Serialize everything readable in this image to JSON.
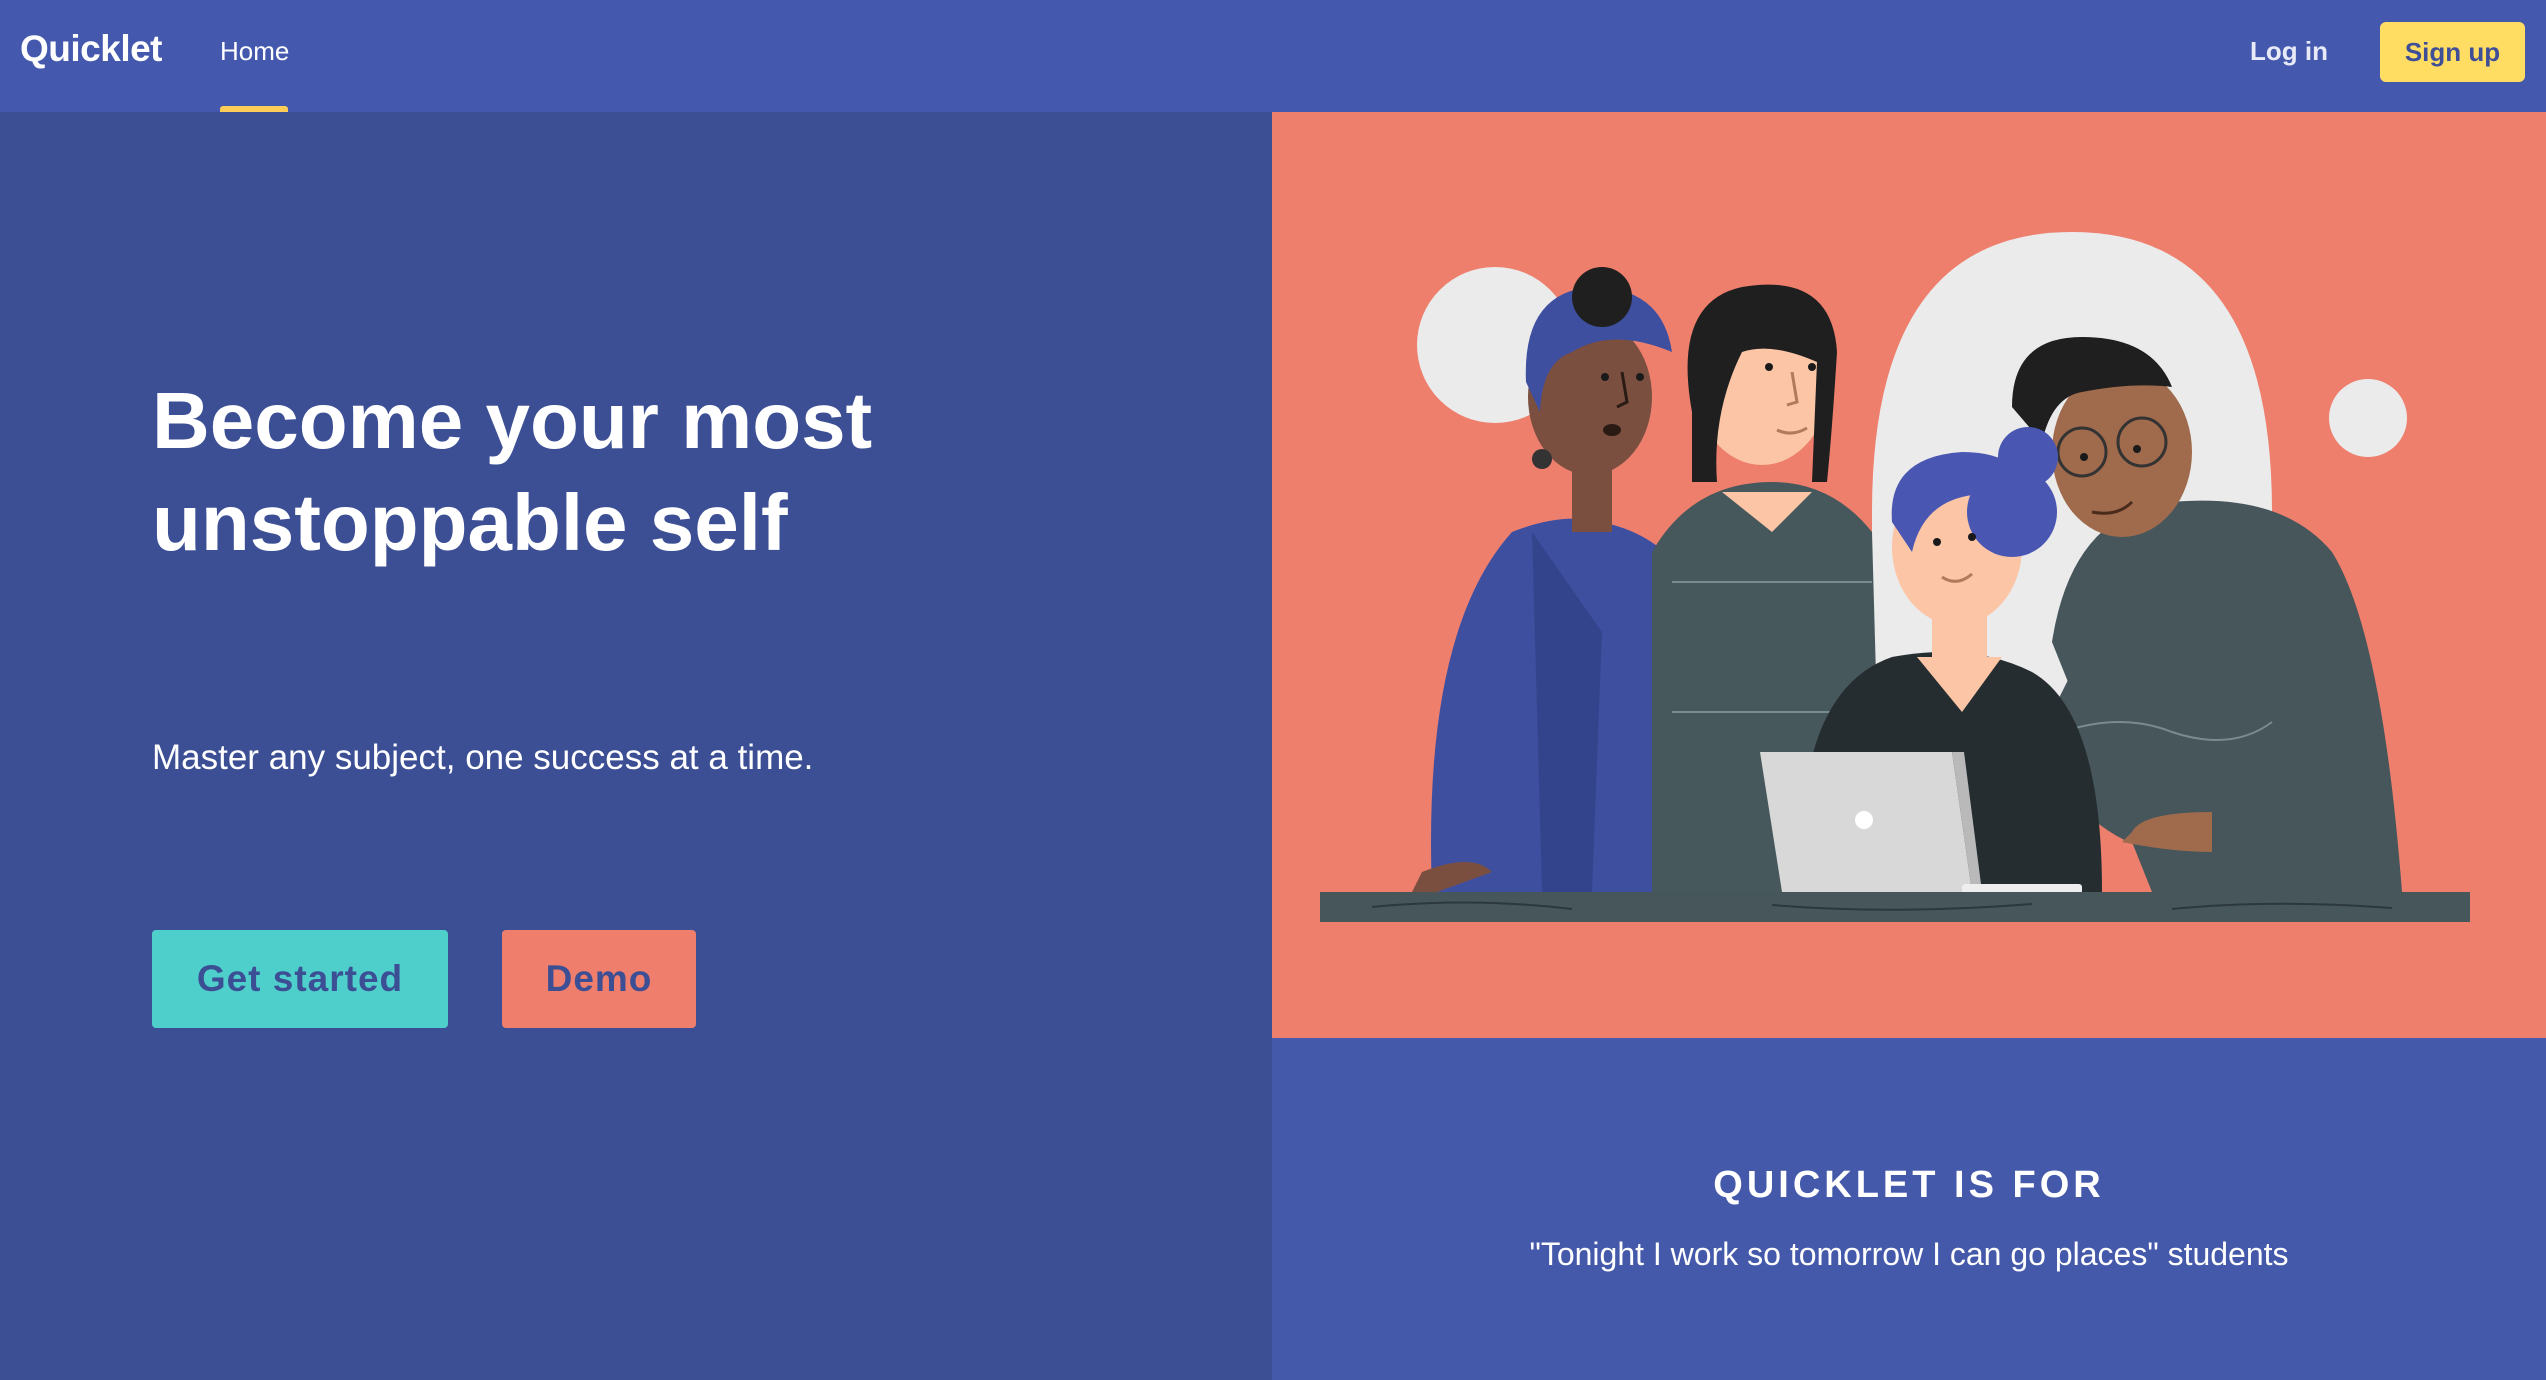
{
  "nav": {
    "brand": "Quicklet",
    "home": "Home",
    "login": "Log in",
    "signup": "Sign up"
  },
  "hero": {
    "title": "Become your most\nunstoppable self",
    "subtitle": "Master any subject, one success at a time.",
    "get_started": "Get started",
    "demo": "Demo"
  },
  "for_section": {
    "title": "QUICKLET IS FOR",
    "quote": "\"Tonight I work so tomorrow I can go places\" students"
  },
  "illustration": {
    "subject": "group-of-people-at-laptop-illustration"
  },
  "colors": {
    "nav_bg": "#4459ad",
    "hero_bg": "#3c4f95",
    "accent_yellow": "#ffdc62",
    "accent_teal": "#4ecfcb",
    "accent_coral": "#ef7e6c",
    "panel_blue": "#4559ab"
  }
}
